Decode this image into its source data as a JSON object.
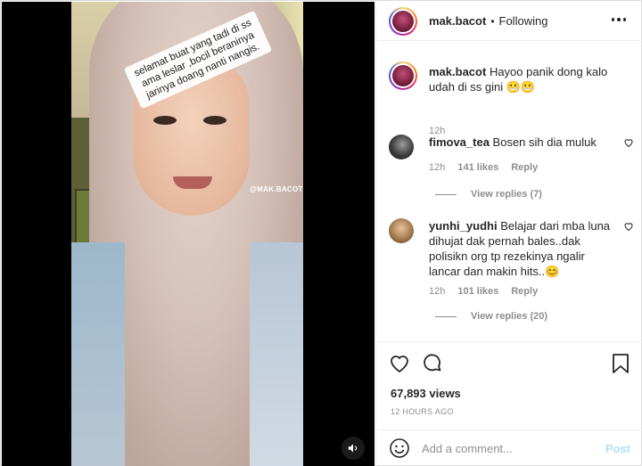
{
  "header": {
    "username": "mak.bacot",
    "separator": "•",
    "follow_status": "Following"
  },
  "video": {
    "overlay_text": "selamat buat yang tadi di ss ama leslar ,bocil beraninya jarinya doang nanti nangis.",
    "watermark": "@MAK.BACOT"
  },
  "caption": {
    "username": "mak.bacot",
    "text": "Hayoo panik dong kalo udah di ss gini 😬😬",
    "time": "12h"
  },
  "comments": [
    {
      "username": "fimova_tea",
      "text": "Bosen sih dia muluk",
      "time": "12h",
      "likes": "141 likes",
      "reply": "Reply",
      "view_replies": "View replies (7)"
    },
    {
      "username": "yunhi_yudhi",
      "text": "Belajar dari mba luna dihujat dak pernah bales..dak polisikn org tp rezekinya ngalir lancar dan makin hits..😊",
      "time": "12h",
      "likes": "101 likes",
      "reply": "Reply",
      "view_replies": "View replies (20)"
    }
  ],
  "stats": {
    "views": "67,893 views",
    "time_ago": "12 HOURS AGO"
  },
  "add_comment": {
    "placeholder": "Add a comment...",
    "post": "Post"
  }
}
